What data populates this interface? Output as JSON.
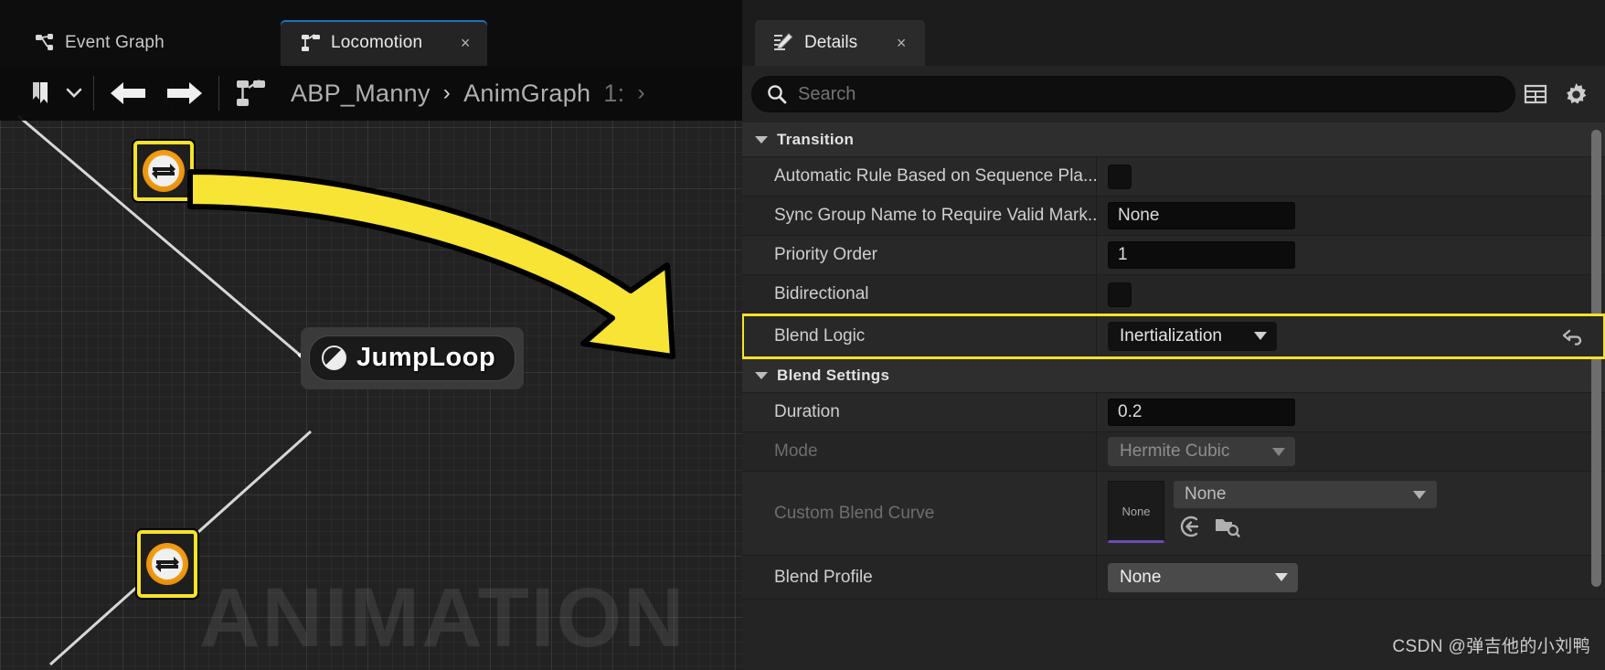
{
  "graph": {
    "tabs": [
      {
        "label": "Event Graph",
        "icon": "event-graph-icon",
        "active": false,
        "closable": false
      },
      {
        "label": "Locomotion",
        "icon": "state-machine-icon",
        "active": true,
        "closable": true,
        "close_label": "×"
      }
    ],
    "toolbar": {
      "bookmark_icon": "bookmark-icon",
      "bookmark_dropdown_icon": "chevron-down-icon",
      "back_icon": "arrow-left-icon",
      "forward_icon": "arrow-right-icon",
      "graph_icon": "state-machine-icon",
      "breadcrumb": [
        {
          "label": "ABP_Manny",
          "dim": false
        },
        {
          "label": "›",
          "sep": true
        },
        {
          "label": "AnimGraph",
          "dim": false
        },
        {
          "label": "1:",
          "dim": true
        },
        {
          "label": "›",
          "sep": true
        }
      ]
    },
    "watermark": "ANIMATION",
    "nodes": [
      {
        "type": "transition",
        "name": "transition-node-upper",
        "selected": true,
        "icon": "transition-arrows-icon"
      },
      {
        "type": "state",
        "name": "state-node-jumploop",
        "label": "JumpLoop",
        "icon": "animation-sequence-icon"
      },
      {
        "type": "transition",
        "name": "transition-node-lower",
        "selected": true,
        "icon": "transition-arrows-icon"
      }
    ],
    "highlight_arrow": {
      "name": "callout-arrow",
      "color": "#f7e435"
    }
  },
  "details": {
    "tab": {
      "label": "Details",
      "icon": "details-icon",
      "close_label": "×"
    },
    "search": {
      "placeholder": "Search",
      "icon": "search-icon",
      "value": ""
    },
    "header_icons": [
      {
        "name": "column-view-icon",
        "glyph": "table"
      },
      {
        "name": "settings-gear-icon",
        "glyph": "gear"
      }
    ],
    "categories": [
      {
        "title": "Transition",
        "expanded": true,
        "rows": [
          {
            "label": "Automatic Rule Based on Sequence Pla...",
            "control": "checkbox",
            "value": "",
            "checked": false,
            "name": "automatic-rule-based-on-sequence-player"
          },
          {
            "label": "Sync Group Name to Require Valid Mark...",
            "control": "text",
            "value": "None",
            "name": "sync-group-name-to-require-valid-markers"
          },
          {
            "label": "Priority Order",
            "control": "text",
            "value": "1",
            "name": "priority-order"
          },
          {
            "label": "Bidirectional",
            "control": "checkbox",
            "value": "",
            "checked": false,
            "name": "bidirectional"
          },
          {
            "label": "Blend Logic",
            "control": "combo",
            "value": "Inertialization",
            "name": "blend-logic",
            "highlighted": true,
            "reset_icon": "reset-to-default-icon"
          }
        ]
      },
      {
        "title": "Blend Settings",
        "expanded": true,
        "rows": [
          {
            "label": "Duration",
            "control": "text",
            "value": "0.2",
            "name": "duration"
          },
          {
            "label": "Mode",
            "control": "combo",
            "value": "Hermite Cubic",
            "name": "mode",
            "disabled": true
          },
          {
            "label": "Custom Blend Curve",
            "control": "asset",
            "value": "None",
            "thumb_label": "None",
            "name": "custom-blend-curve",
            "disabled": true,
            "buttons": [
              {
                "name": "use-selected-asset-icon"
              },
              {
                "name": "browse-to-asset-icon"
              }
            ]
          },
          {
            "label": "Blend Profile",
            "control": "combo",
            "value": "None",
            "name": "blend-profile"
          }
        ]
      }
    ],
    "scrollbar": {
      "name": "details-scrollbar"
    }
  },
  "watermark_credit": "CSDN @弹吉他的小刘鸭",
  "colors": {
    "accent_yellow": "#f6e22a",
    "tab_active_underline": "#1675c4",
    "asset_accent": "#6a4bb5"
  }
}
